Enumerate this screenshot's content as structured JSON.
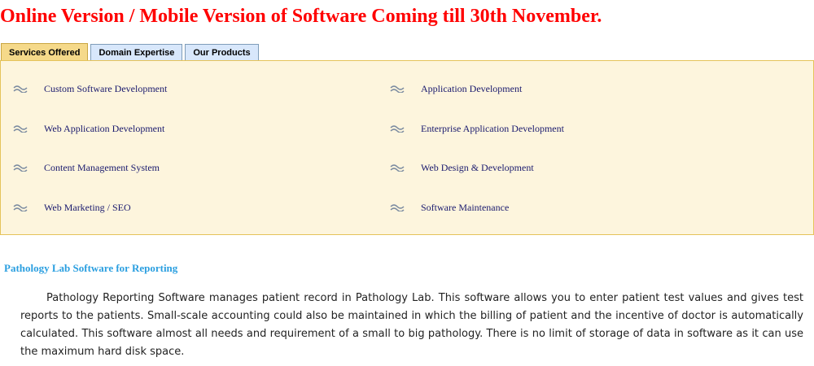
{
  "announcement": "Online Version / Mobile Version of Software Coming till 30th November.",
  "tabs": [
    {
      "label": "Services Offered",
      "active": true
    },
    {
      "label": "Domain Expertise",
      "active": false
    },
    {
      "label": "Our Products",
      "active": false
    }
  ],
  "services": {
    "icon": "tilde-bullet-icon",
    "left": [
      "Custom Software Development",
      "Web Application Development",
      "Content Management System",
      "Web Marketing / SEO"
    ],
    "right": [
      "Application Development",
      "Enterprise Application Development",
      "Web Design & Development",
      "Software Maintenance"
    ]
  },
  "section": {
    "title": "Pathology Lab Software for Reporting",
    "body": "Pathology Reporting Software manages patient record in Pathology Lab. This software allows you to enter patient test values and gives test reports to the patients. Small-scale accounting could also be maintained in which the billing of patient and the incentive of doctor is automatically calculated. This software almost all needs and requirement of a small to big pathology. There is no limit of storage of data in software as it can use the maximum hard disk space."
  },
  "colors": {
    "announcement": "#ff0000",
    "active_tab": "#f5d98a",
    "inactive_tab": "#d8e7fb",
    "panel_bg": "#fdf5dd",
    "panel_border": "#e5c35a",
    "service_text": "#1a1a6e",
    "section_title": "#2b9fe0"
  }
}
